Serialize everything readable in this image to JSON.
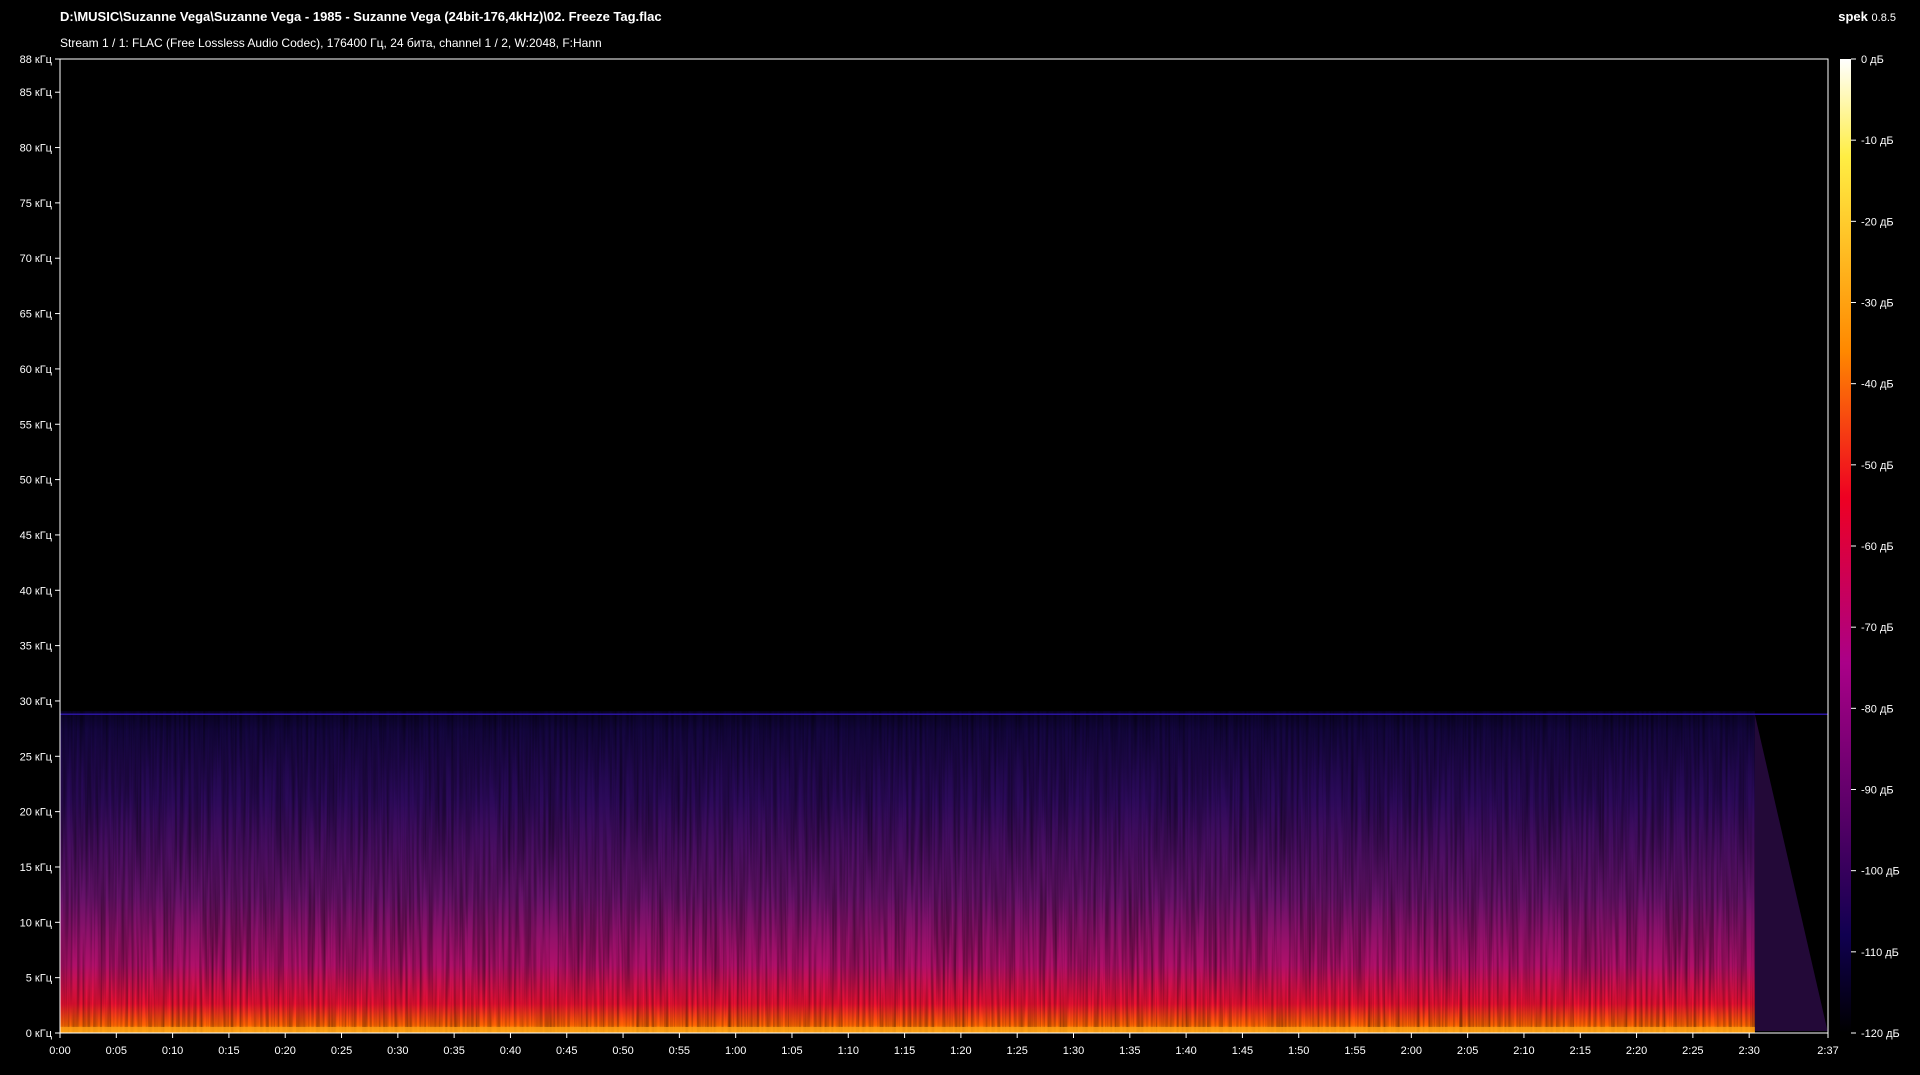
{
  "window": {
    "file_path": "D:\\MUSIC\\Suzanne Vega\\Suzanne Vega - 1985 - Suzanne Vega (24bit-176,4kHz)\\02. Freeze Tag.flac",
    "stream_info": "Stream 1 / 1: FLAC (Free Lossless Audio Codec), 176400 Гц, 24 бита, channel 1 / 2, W:2048, F:Hann",
    "app_name": "spek",
    "app_version": "0.8.5"
  },
  "chart_data": {
    "type": "heatmap",
    "y_ticks": [
      "0 кГц",
      "5 кГц",
      "10 кГц",
      "15 кГц",
      "20 кГц",
      "25 кГц",
      "30 кГц",
      "35 кГц",
      "40 кГц",
      "45 кГц",
      "50 кГц",
      "55 кГц",
      "60 кГц",
      "65 кГц",
      "70 кГц",
      "75 кГц",
      "80 кГц",
      "85 кГц",
      "88 кГц"
    ],
    "y_tick_values": [
      0,
      5,
      10,
      15,
      20,
      25,
      30,
      35,
      40,
      45,
      50,
      55,
      60,
      65,
      70,
      75,
      80,
      85,
      88
    ],
    "ylim": [
      0,
      88
    ],
    "x_ticks": [
      "0:00",
      "0:05",
      "0:10",
      "0:15",
      "0:20",
      "0:25",
      "0:30",
      "0:35",
      "0:40",
      "0:45",
      "0:50",
      "0:55",
      "1:00",
      "1:05",
      "1:10",
      "1:15",
      "1:20",
      "1:25",
      "1:30",
      "1:35",
      "1:40",
      "1:45",
      "1:50",
      "1:55",
      "2:00",
      "2:05",
      "2:10",
      "2:15",
      "2:20",
      "2:25",
      "2:30",
      "2:37"
    ],
    "x_tick_values": [
      0,
      5,
      10,
      15,
      20,
      25,
      30,
      35,
      40,
      45,
      50,
      55,
      60,
      65,
      70,
      75,
      80,
      85,
      90,
      95,
      100,
      105,
      110,
      115,
      120,
      125,
      130,
      135,
      140,
      145,
      150,
      157
    ],
    "xlim": [
      0,
      157
    ],
    "db_ticks": [
      "0 дБ",
      "-10 дБ",
      "-20 дБ",
      "-30 дБ",
      "-40 дБ",
      "-50 дБ",
      "-60 дБ",
      "-70 дБ",
      "-80 дБ",
      "-90 дБ",
      "-100 дБ",
      "-110 дБ",
      "-120 дБ"
    ],
    "db_range": [
      -120,
      0
    ],
    "cutoff_khz": 28.8,
    "colors": {
      "bar_top": "#ffffff",
      "bar_yellow": "#ffee44",
      "bar_orange": "#ff8800",
      "bar_red": "#ee0022",
      "bar_magenta": "#aa0088",
      "bar_purple": "#550066",
      "bar_navy": "#100050",
      "bar_bottom": "#000000"
    }
  }
}
